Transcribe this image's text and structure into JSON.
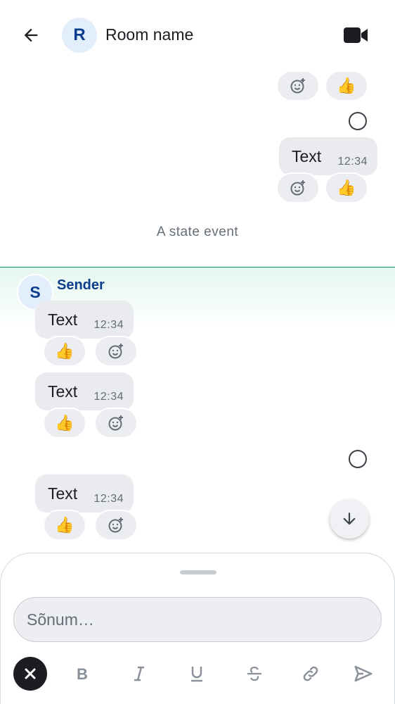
{
  "header": {
    "back_icon": "arrow-left-icon",
    "room_avatar_letter": "R",
    "room_name": "Room name",
    "video_icon": "video-call-icon"
  },
  "timeline": {
    "outgoing": [
      {
        "reaction": "👍"
      },
      {
        "text": "Text",
        "time": "12:34",
        "reaction": "👍"
      }
    ],
    "state_event": "A state event",
    "sender": {
      "avatar_letter": "S",
      "name": "Sender"
    },
    "incoming": [
      {
        "text": "Text",
        "time": "12:34",
        "reaction": "👍"
      },
      {
        "text": "Text",
        "time": "12:34",
        "reaction": "👍"
      },
      {
        "text": "Text",
        "time": "12:34",
        "reaction": "👍"
      }
    ]
  },
  "composer": {
    "placeholder": "Sõnum…",
    "format_buttons": [
      "close-format-icon",
      "bold-icon",
      "italic-icon",
      "underline-icon",
      "strikethrough-icon",
      "link-icon",
      "send-icon"
    ]
  },
  "colors": {
    "accent": "#0b3f8e",
    "bubble": "#e9ebef",
    "new_divider": "#0c8a5c"
  }
}
